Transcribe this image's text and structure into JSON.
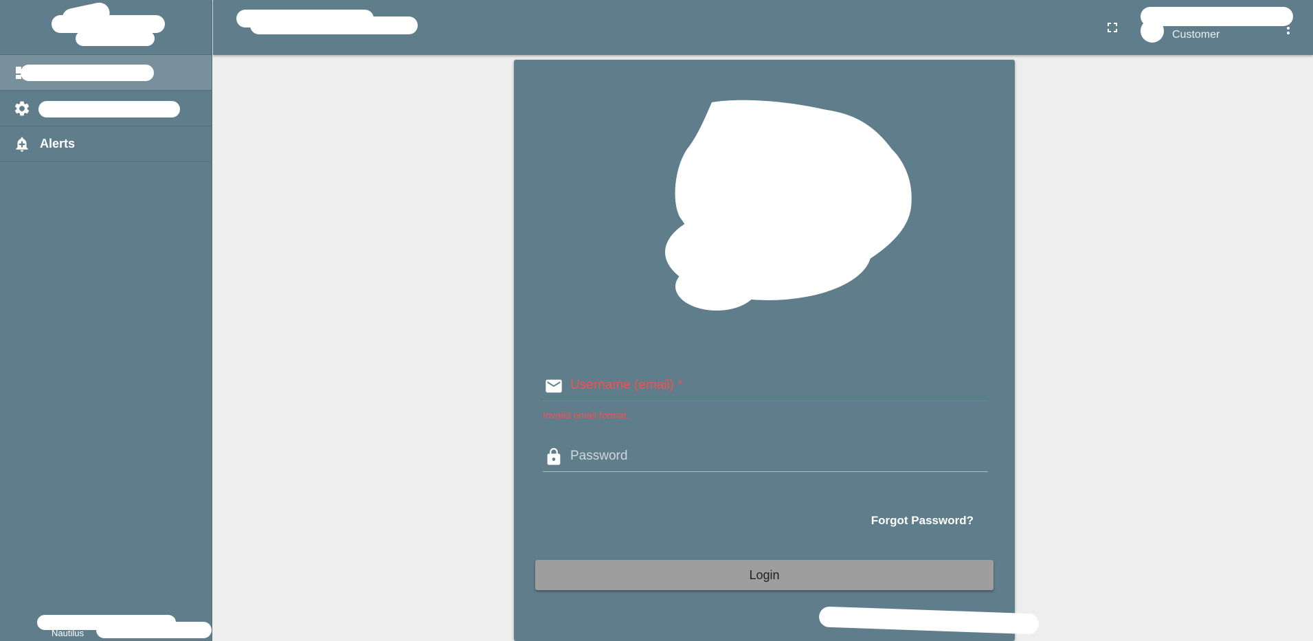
{
  "sidebar": {
    "items": [
      {
        "label": "",
        "icon": "dashboard-icon",
        "active": true
      },
      {
        "label": "",
        "icon": "gear-icon",
        "active": false
      },
      {
        "label": "Alerts",
        "icon": "bell-plus-icon",
        "active": false
      }
    ],
    "footer_text": "Nautilus"
  },
  "header": {
    "title": "",
    "user_role": "Customer",
    "fullscreen_icon": "fullscreen-icon",
    "menu_icon": "more-vertical-icon"
  },
  "login": {
    "username_placeholder": "Username (email) *",
    "username_error": "Invalid email format.",
    "password_placeholder": "Password",
    "forgot_label": "Forgot Password?",
    "login_label": "Login"
  },
  "colors": {
    "primary": "#607d8b",
    "background": "#eeeeee",
    "error": "#ef5350",
    "button": "#9e9e9e"
  }
}
